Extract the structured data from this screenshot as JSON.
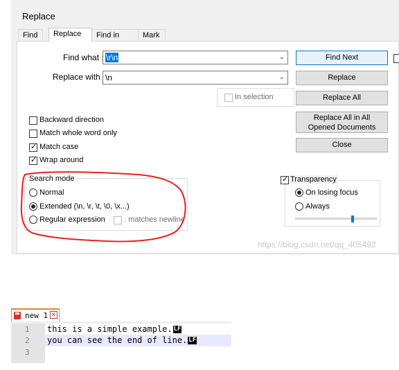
{
  "dialog": {
    "title": "Replace",
    "tabs": [
      "Find",
      "Replace",
      "Find in Files",
      "Mark"
    ],
    "find_label": "Find what :",
    "find_value": "\\r\\n",
    "replace_label": "Replace with :",
    "replace_value": "\\n",
    "in_selection_label": "In selection",
    "buttons": {
      "find_next": "Find Next",
      "replace": "Replace",
      "replace_all": "Replace All",
      "replace_all_opened": "Replace All in All Opened Documents",
      "close": "Close"
    },
    "options": {
      "backward": "Backward direction",
      "whole_word": "Match whole word only",
      "match_case": "Match case",
      "wrap_around": "Wrap around"
    },
    "search_mode": {
      "title": "Search mode",
      "normal": "Normal",
      "extended": "Extended (\\n, \\r, \\t, \\0, \\x...)",
      "regex": "Regular expression",
      "matches_newline": ". matches newline",
      "selected": "extended"
    },
    "transparency": {
      "label": "Transparency",
      "on_losing_focus": "On losing focus",
      "always": "Always",
      "level": 0.7
    },
    "watermark": "https://blog.csdn.net/qq_405492"
  },
  "editor": {
    "tab_label": "new 1",
    "lines": [
      {
        "num": "1",
        "text": "this is a simple example."
      },
      {
        "num": "2",
        "text": "you can see the end of line."
      },
      {
        "num": "3",
        "text": ""
      }
    ],
    "eol_marker": "LF"
  },
  "colors": {
    "accent": "#0078d7",
    "annotation": "#e8201c",
    "tab_accent": "#e08a20"
  }
}
